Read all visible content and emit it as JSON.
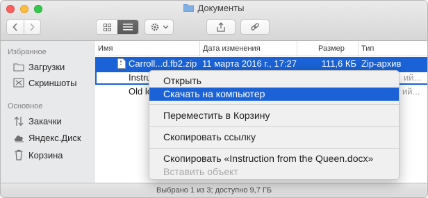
{
  "window": {
    "title": "Документы"
  },
  "toolbar": {
    "back_icon": "chevron-left-icon",
    "forward_icon": "chevron-right-icon",
    "icon_view": "grid-icon",
    "list_view": "list-icon",
    "action_icon": "gear-icon",
    "share_icon": "share-icon",
    "link_icon": "link-icon"
  },
  "sidebar": {
    "favorites_heading": "Избранное",
    "favorites": [
      {
        "label": "Загрузки",
        "icon": "folder-icon"
      },
      {
        "label": "Скриншоты",
        "icon": "scissors-icon"
      }
    ],
    "main_heading": "Основное",
    "main": [
      {
        "label": "Закачки",
        "icon": "sync-arrows-icon"
      },
      {
        "label": "Яндекс.Диск",
        "icon": "cloud-icon"
      },
      {
        "label": "Корзина",
        "icon": "trash-icon"
      }
    ]
  },
  "list": {
    "columns": {
      "name": "Имя",
      "date": "Дата изменения",
      "size": "Размер",
      "type": "Тип"
    },
    "rows": [
      {
        "name": "Carroll...d.fb2.zip",
        "date": "11 марта 2016 г., 17:27",
        "size": "111,6 КБ",
        "type": "Zip-архив",
        "selected": true
      },
      {
        "name": "Instru",
        "date": "",
        "size": "",
        "type": "ий...",
        "selected": false
      },
      {
        "name": "Old lo",
        "date": "",
        "size": "",
        "type": "ий...",
        "selected": false
      }
    ]
  },
  "context_menu": {
    "open": "Открыть",
    "download": "Скачать на компьютер",
    "move_to_trash": "Переместить в Корзину",
    "copy_link": "Скопировать ссылку",
    "copy_item": "Скопировать «Instruction from the Queen.docx»",
    "paste": "Вставить объект"
  },
  "status": {
    "text": "Выбрано 1 из 3; доступно 9,7 ГБ"
  },
  "colors": {
    "selection": "#1a62d6",
    "sidebar": "#e8e9eb",
    "folder": "#7fb0e6"
  }
}
